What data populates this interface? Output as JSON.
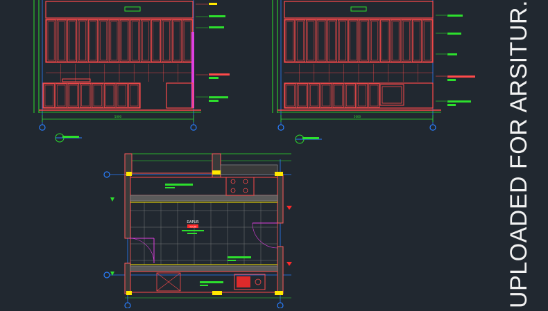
{
  "watermark": "UPLOADED FOR ARSITUR.COM",
  "colors": {
    "background": "#212830",
    "cabinet": "#ff4a4a",
    "dimension": "#2de02d",
    "wall": "#ff5a5a",
    "hatch": "#9a9a9a",
    "tag": "#ffe800",
    "axis": "#2a7fff",
    "magenta": "#e040e0",
    "white": "#ffffff"
  },
  "elevation_left": {
    "dim_total": "5000"
  },
  "elevation_right": {
    "dim_total": "5000"
  },
  "plan": {
    "room_name": "DAPUR",
    "room_level": "+0.00"
  }
}
